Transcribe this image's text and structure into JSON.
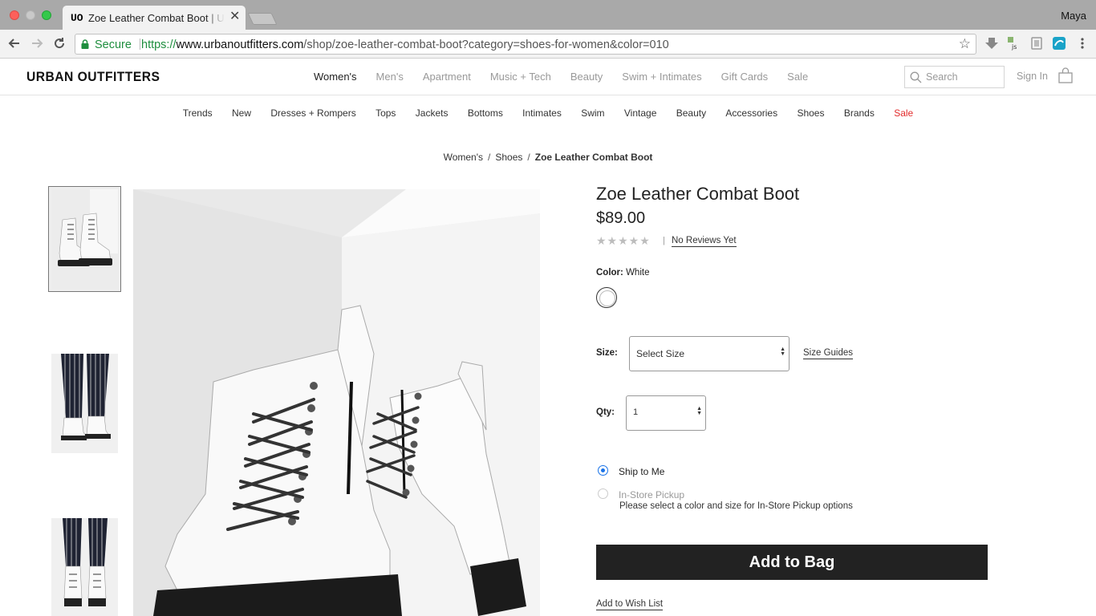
{
  "browser": {
    "tab_title": "Zoe Leather Combat Boot | Urban Outfitters",
    "tab_favicon": "UO",
    "profile_name": "Maya",
    "secure_label": "Secure",
    "url_scheme": "https://",
    "url_host": "www.urbanoutfitters.com",
    "url_path": "/shop/zoe-leather-combat-boot?category=shoes-for-women&color=010"
  },
  "header": {
    "logo": "URBAN OUTFITTERS",
    "nav": [
      "Women's",
      "Men's",
      "Apartment",
      "Music + Tech",
      "Beauty",
      "Swim + Intimates",
      "Gift Cards",
      "Sale"
    ],
    "search_placeholder": "Search",
    "sign_in": "Sign In"
  },
  "category_nav": [
    "Trends",
    "New",
    "Dresses + Rompers",
    "Tops",
    "Jackets",
    "Bottoms",
    "Intimates",
    "Swim",
    "Vintage",
    "Beauty",
    "Accessories",
    "Shoes",
    "Brands",
    "Sale"
  ],
  "breadcrumb": [
    "Women's",
    "Shoes",
    "Zoe Leather Combat Boot"
  ],
  "product": {
    "title": "Zoe Leather Combat Boot",
    "price": "$89.00",
    "rating_stars": "★★★★★",
    "reviews": "No Reviews Yet",
    "color_label": "Color:",
    "color_value": "White",
    "size_label": "Size:",
    "size_value": "Select Size",
    "size_guides": "Size Guides",
    "qty_label": "Qty:",
    "qty_value": "1",
    "ship_to_me": "Ship to Me",
    "in_store_pickup": "In-Store Pickup",
    "pickup_note": "Please select a color and size for In-Store Pickup options",
    "add_to_bag": "Add to Bag",
    "add_to_wishlist": "Add to Wish List"
  },
  "colors": {
    "accent_blue": "#1a73e8",
    "sale_red": "#e22c2c",
    "button_dark": "#222222"
  }
}
